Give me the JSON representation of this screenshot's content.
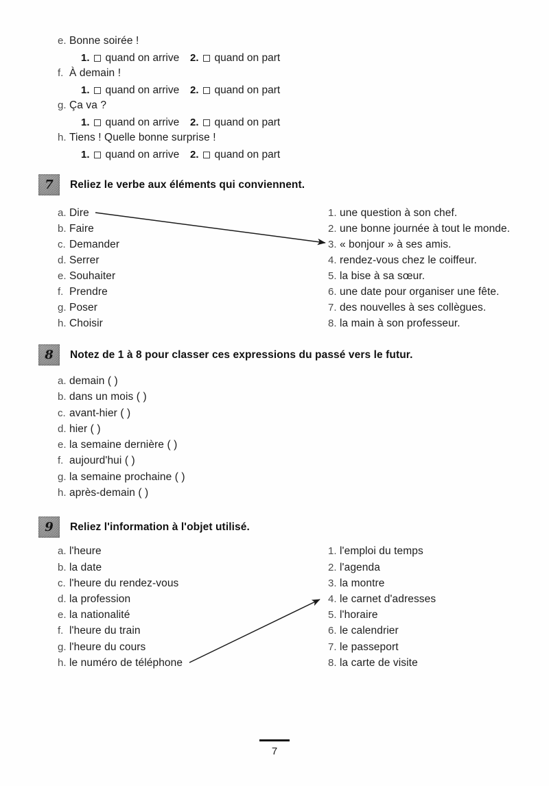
{
  "page": {
    "number": "7",
    "paper_color": "#fefefe",
    "ink_color": "#1c1c1c",
    "badge_color": "#8a8a8a"
  },
  "top_exercise": {
    "option_labels": {
      "num1": "1.",
      "num2": "2.",
      "label1": "quand on arrive",
      "label2": "quand on part"
    },
    "items": [
      {
        "marker": "e.",
        "text": "Bonne soirée !"
      },
      {
        "marker": "f.",
        "text": "À demain !"
      },
      {
        "marker": "g.",
        "text": "Ça va ?"
      },
      {
        "marker": "h.",
        "text": "Tiens ! Quelle bonne surprise !"
      }
    ]
  },
  "exercises": [
    {
      "number": "7",
      "title": "Reliez le verbe aux éléments qui conviennent.",
      "left": [
        {
          "marker": "a.",
          "text": "Dire"
        },
        {
          "marker": "b.",
          "text": "Faire"
        },
        {
          "marker": "c.",
          "text": "Demander"
        },
        {
          "marker": "d.",
          "text": "Serrer"
        },
        {
          "marker": "e.",
          "text": "Souhaiter"
        },
        {
          "marker": "f.",
          "text": "Prendre"
        },
        {
          "marker": "g.",
          "text": "Poser"
        },
        {
          "marker": "h.",
          "text": "Choisir"
        }
      ],
      "right": [
        {
          "marker": "1.",
          "text": "une question à son chef."
        },
        {
          "marker": "2.",
          "text": "une bonne journée à tout le monde."
        },
        {
          "marker": "3.",
          "text": "« bonjour » à ses amis."
        },
        {
          "marker": "4.",
          "text": "rendez-vous chez le coiffeur."
        },
        {
          "marker": "5.",
          "text": "la bise à sa sœur."
        },
        {
          "marker": "6.",
          "text": "une date pour organiser une fête."
        },
        {
          "marker": "7.",
          "text": "des nouvelles à ses collègues."
        },
        {
          "marker": "8.",
          "text": "la main à son professeur."
        }
      ],
      "connection": {
        "from": "a. Dire",
        "to": "3. « bonjour » à ses amis."
      }
    },
    {
      "number": "8",
      "title": "Notez de 1 à 8 pour classer ces expressions du passé vers le futur.",
      "left": [
        {
          "marker": "a.",
          "text": "demain (   )"
        },
        {
          "marker": "b.",
          "text": "dans un mois (   )"
        },
        {
          "marker": "c.",
          "text": "avant-hier (   )"
        },
        {
          "marker": "d.",
          "text": "hier (   )"
        },
        {
          "marker": "e.",
          "text": "la semaine dernière (   )"
        },
        {
          "marker": "f.",
          "text": "aujourd'hui (   )"
        },
        {
          "marker": "g.",
          "text": "la semaine prochaine (   )"
        },
        {
          "marker": "h.",
          "text": "après-demain (   )"
        }
      ],
      "right": [],
      "connection": null
    },
    {
      "number": "9",
      "title": "Reliez l'information à l'objet utilisé.",
      "left": [
        {
          "marker": "a.",
          "text": "l'heure"
        },
        {
          "marker": "b.",
          "text": "la date"
        },
        {
          "marker": "c.",
          "text": "l'heure du rendez-vous"
        },
        {
          "marker": "d.",
          "text": "la profession"
        },
        {
          "marker": "e.",
          "text": "la nationalité"
        },
        {
          "marker": "f.",
          "text": "l'heure du train"
        },
        {
          "marker": "g.",
          "text": "l'heure du cours"
        },
        {
          "marker": "h.",
          "text": "le numéro de téléphone"
        }
      ],
      "right": [
        {
          "marker": "1.",
          "text": "l'emploi du temps"
        },
        {
          "marker": "2.",
          "text": "l'agenda"
        },
        {
          "marker": "3.",
          "text": "la montre"
        },
        {
          "marker": "4.",
          "text": "le carnet d'adresses"
        },
        {
          "marker": "5.",
          "text": "l'horaire"
        },
        {
          "marker": "6.",
          "text": "le calendrier"
        },
        {
          "marker": "7.",
          "text": "le passeport"
        },
        {
          "marker": "8.",
          "text": "la carte de visite"
        }
      ],
      "connection": {
        "from": "h. le numéro de téléphone",
        "to": "4. le carnet d'adresses"
      }
    }
  ]
}
